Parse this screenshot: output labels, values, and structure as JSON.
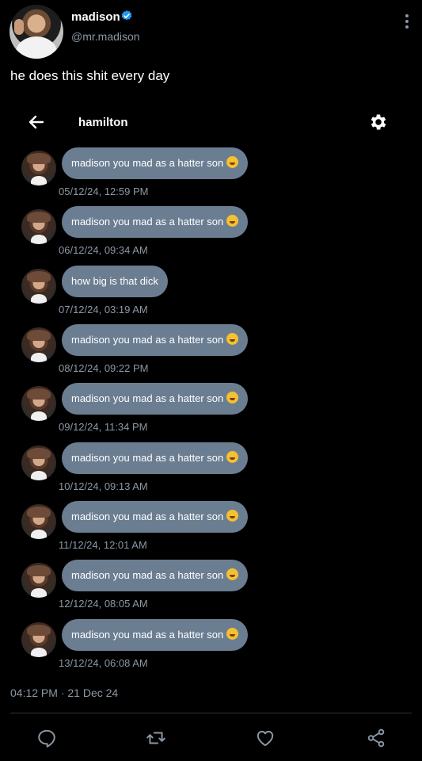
{
  "tweet": {
    "author": "madison",
    "handle": "@mr.madison",
    "text": "he does this shit every day",
    "time": "04:12 PM · 21 Dec 24"
  },
  "dm": {
    "title": "hamilton",
    "messages": [
      {
        "text": "madison you mad as a hatter son",
        "emoji": "grinning-sweat-emoji",
        "time": "05/12/24, 12:59 PM"
      },
      {
        "text": "madison you mad as a hatter son",
        "emoji": "grinning-sweat-emoji",
        "time": "06/12/24, 09:34 AM"
      },
      {
        "text": "how big is that dick",
        "emoji": "",
        "time": "07/12/24, 03:19 AM"
      },
      {
        "text": "madison you mad as a hatter son",
        "emoji": "grinning-sweat-emoji",
        "time": "08/12/24, 09:22 PM"
      },
      {
        "text": "madison you mad as a hatter son",
        "emoji": "grinning-sweat-emoji",
        "time": "09/12/24, 11:34 PM"
      },
      {
        "text": "madison you mad as a hatter son",
        "emoji": "grinning-sweat-emoji",
        "time": "10/12/24, 09:13 AM"
      },
      {
        "text": "madison you mad as a hatter son",
        "emoji": "grinning-sweat-emoji",
        "time": "11/12/24, 12:01 AM"
      },
      {
        "text": "madison you mad as a hatter son",
        "emoji": "grinning-sweat-emoji",
        "time": "12/12/24, 08:05 AM"
      },
      {
        "text": "madison you mad as a hatter son",
        "emoji": "grinning-sweat-emoji",
        "time": "13/12/24, 06:08 AM"
      }
    ]
  },
  "colors": {
    "background": "#000000",
    "bubble": "#6b7d91",
    "muted_text": "#8b98a5",
    "verified": "#1d9bf0"
  },
  "icons": {
    "verified": "verified-badge-icon",
    "more": "more-vertical-icon",
    "back": "arrow-left-icon",
    "settings": "gear-icon",
    "reply": "reply-icon",
    "retweet": "retweet-icon",
    "like": "heart-icon",
    "share": "share-icon"
  }
}
